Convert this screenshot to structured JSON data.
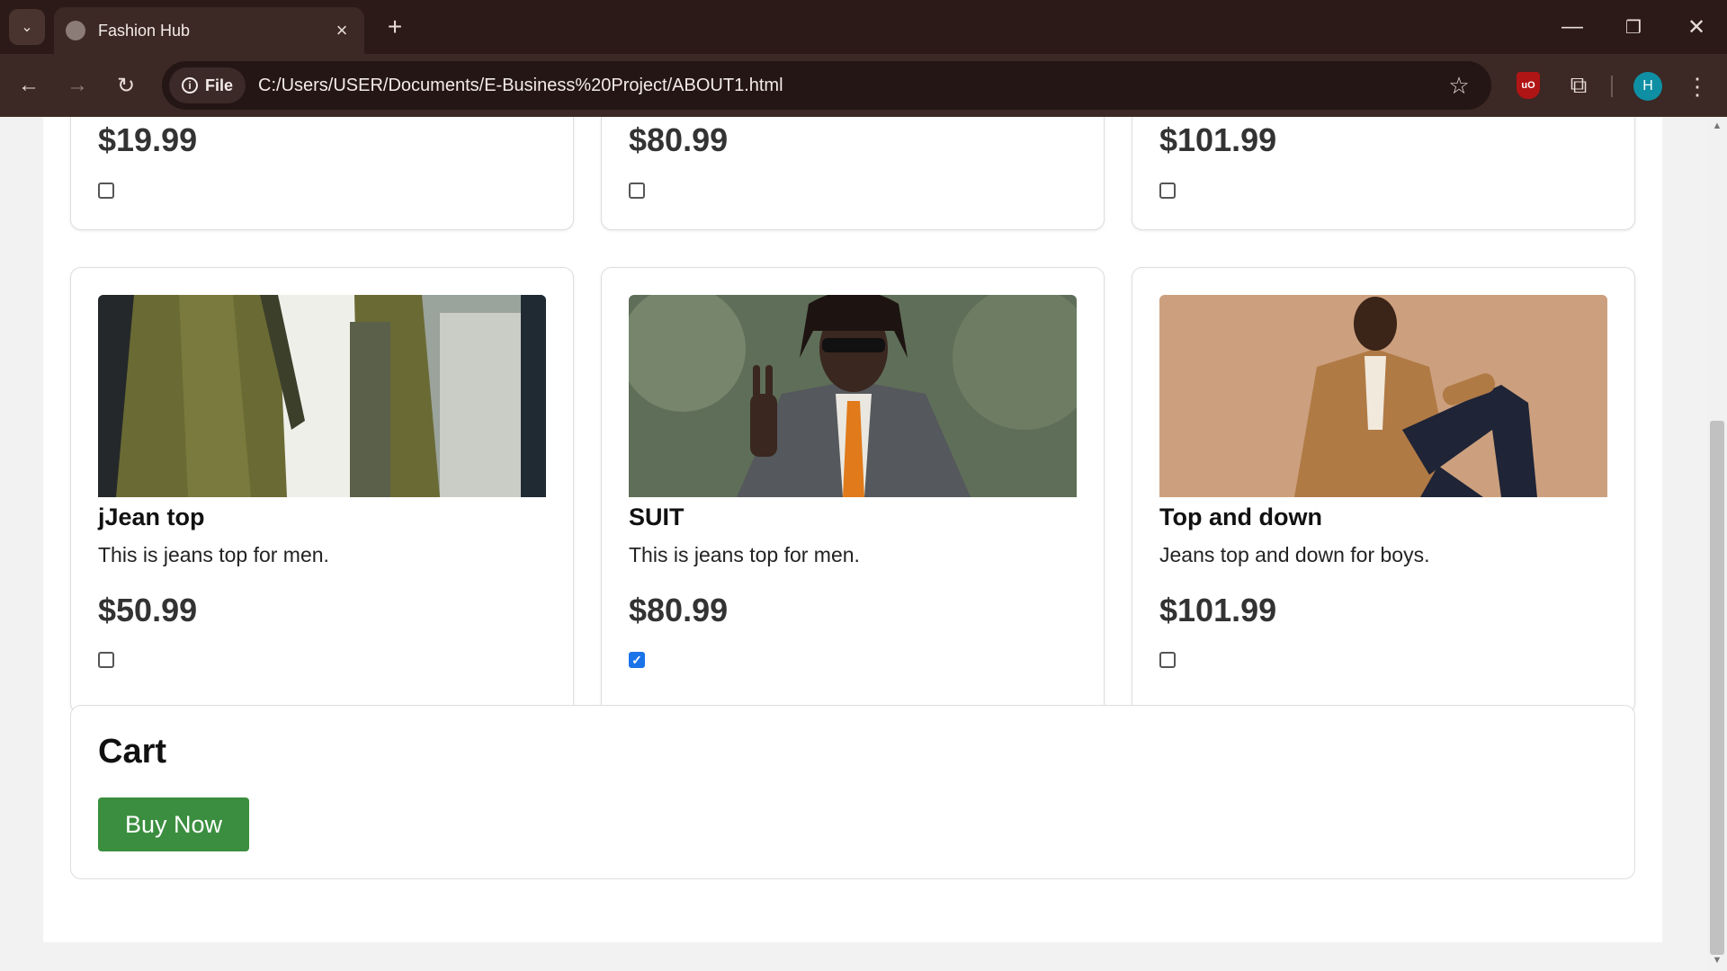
{
  "browser": {
    "tab_title": "Fashion Hub",
    "url": "C:/Users/USER/Documents/E-Business%20Project/ABOUT1.html",
    "file_chip": "File",
    "profile_initial": "H",
    "ublock_label": "uO"
  },
  "top_row": [
    {
      "price": "$19.99",
      "checked": false
    },
    {
      "price": "$80.99",
      "checked": false
    },
    {
      "price": "$101.99",
      "checked": false
    }
  ],
  "products": [
    {
      "name": "jJean top",
      "description": "This is jeans top for men.",
      "price": "$50.99",
      "checked": false,
      "image": "man-olive-jacket-photo"
    },
    {
      "name": "SUIT",
      "description": "This is jeans top for men.",
      "price": "$80.99",
      "checked": true,
      "image": "man-sunglasses-leather-jacket-photo"
    },
    {
      "name": "Top and down",
      "description": "Jeans top and down for boys.",
      "price": "$101.99",
      "checked": false,
      "image": "man-tan-shirt-photo"
    }
  ],
  "cart": {
    "title": "Cart",
    "buy_label": "Buy Now"
  }
}
